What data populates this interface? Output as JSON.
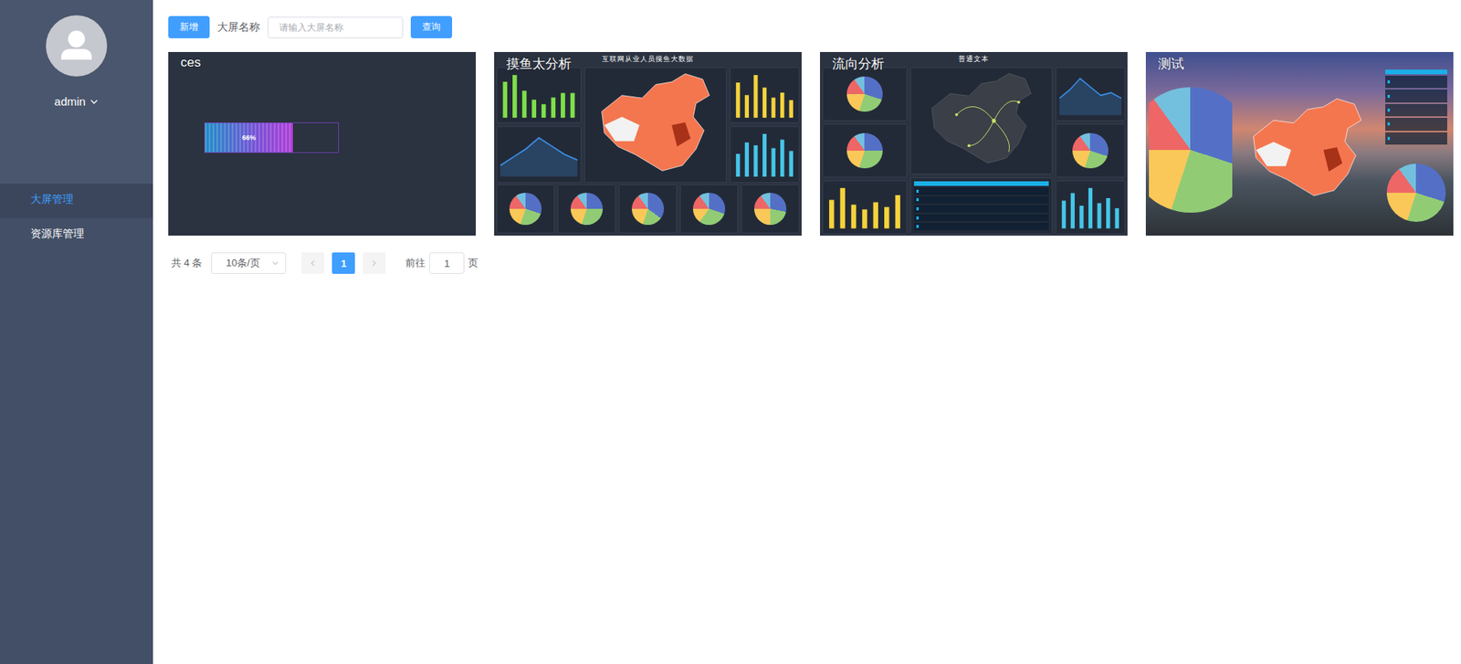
{
  "sidebar": {
    "user": "admin",
    "items": [
      {
        "label": "大屏管理",
        "selected": true
      },
      {
        "label": "资源库管理",
        "selected": false
      }
    ]
  },
  "toolbar": {
    "add_button": "新增",
    "search_label": "大屏名称",
    "search_placeholder": "请输入大屏名称",
    "search_value": "",
    "query_button": "查询"
  },
  "palette": [
    "#5470c6",
    "#91cc75",
    "#fac858",
    "#ee6666",
    "#73c0de"
  ],
  "cards": [
    {
      "name": "ces",
      "thumbnail": {
        "kind": "progress",
        "level": 0.66,
        "label": "66%"
      }
    },
    {
      "name": "摸鱼太分析",
      "thumbnail": {
        "kind": "dashboard",
        "photo": false,
        "heading": "互联网从业人员摸鱼大数据",
        "left": [
          {
            "kind": "bars",
            "color": "#7ee04a",
            "values": [
              80,
              95,
              60,
              40,
              30,
              45,
              55,
              55
            ]
          },
          {
            "kind": "line",
            "color": "#3a8ee6",
            "values": [
              20,
              35,
              50,
              70,
              55,
              40,
              30
            ]
          }
        ],
        "center": [
          {
            "kind": "map",
            "color": "#f4764f"
          }
        ],
        "right": [
          {
            "kind": "bars",
            "color": "#f5d33b",
            "values": [
              70,
              45,
              85,
              60,
              40,
              50,
              35
            ]
          },
          {
            "kind": "bars",
            "color": "#45c6e8",
            "values": [
              40,
              60,
              55,
              75,
              50,
              65,
              45
            ]
          }
        ],
        "bottom": [
          {
            "kind": "pie",
            "values": [
              30,
              25,
              20,
              15,
              10
            ]
          },
          {
            "kind": "pie",
            "values": [
              25,
              30,
              20,
              15,
              10
            ]
          },
          {
            "kind": "pie",
            "values": [
              35,
              20,
              20,
              15,
              10
            ]
          },
          {
            "kind": "pie",
            "values": [
              30,
              30,
              15,
              15,
              10
            ]
          },
          {
            "kind": "pie",
            "values": [
              28,
              22,
              25,
              15,
              10
            ]
          }
        ]
      }
    },
    {
      "name": "流向分析",
      "thumbnail": {
        "kind": "dashboard",
        "photo": false,
        "heading": "普通文本",
        "left": [
          {
            "kind": "pie",
            "values": [
              30,
              25,
              20,
              15,
              10
            ]
          },
          {
            "kind": "pie",
            "values": [
              25,
              30,
              20,
              15,
              10
            ]
          },
          {
            "kind": "bars",
            "color": "#f5d33b",
            "values": [
              60,
              85,
              50,
              40,
              55,
              45,
              70
            ]
          }
        ],
        "center": [
          {
            "kind": "flow",
            "color": "#c8e06a"
          },
          {
            "kind": "table",
            "color": "#1ab0e8",
            "rows": 5
          }
        ],
        "right": [
          {
            "kind": "line",
            "color": "#3a8ee6",
            "values": [
              30,
              45,
              65,
              50,
              35,
              40,
              30
            ]
          },
          {
            "kind": "pie",
            "values": [
              30,
              25,
              20,
              15,
              10
            ]
          },
          {
            "kind": "bars",
            "color": "#45c6e8",
            "values": [
              55,
              70,
              45,
              80,
              50,
              60,
              40
            ]
          }
        ],
        "bottom": []
      }
    },
    {
      "name": "测试",
      "thumbnail": {
        "kind": "dashboard",
        "photo": true,
        "left": [
          {
            "kind": "pie",
            "values": [
              30,
              25,
              20,
              15,
              10
            ]
          }
        ],
        "center": [
          {
            "kind": "map",
            "color": "#f4764f"
          }
        ],
        "right": [
          {
            "kind": "table",
            "color": "#1ab0e8",
            "rows": 5
          },
          {
            "kind": "pie",
            "values": [
              30,
              25,
              20,
              15,
              10
            ]
          }
        ],
        "bottom": []
      }
    }
  ],
  "pagination": {
    "total": "共 4 条",
    "page_size": "10条/页",
    "prev_disabled": true,
    "next_disabled": true,
    "pages": [
      {
        "label": "1",
        "selected": true
      }
    ],
    "goto_label": "前往",
    "goto_value": "1",
    "goto_suffix": "页"
  }
}
